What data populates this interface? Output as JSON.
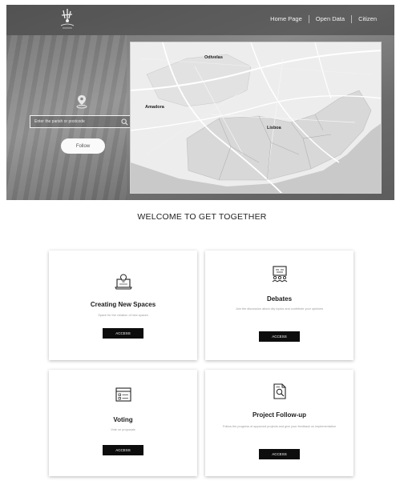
{
  "header": {
    "nav": [
      "Home Page",
      "Open Data",
      "Citizen"
    ]
  },
  "hero": {
    "search_placeholder": "Enter the parish or postcode",
    "follow_label": "Follow"
  },
  "map": {
    "labels": [
      "Odivelas",
      "Amadora",
      "Lisboa"
    ]
  },
  "welcome_title": "WELCOME TO GET TOGETHER",
  "cards": [
    {
      "title": "Creating New Spaces",
      "description": "Space for the creation of new spaces",
      "button": "ACCESS",
      "icon": "laptop-idea-icon"
    },
    {
      "title": "Debates",
      "description": "Join the discussion about city topics and contribute your opinions",
      "button": "ACCESS",
      "icon": "debate-board-icon"
    },
    {
      "title": "Voting",
      "description": "Vote on proposals",
      "button": "ACCESS",
      "icon": "ballot-icon"
    },
    {
      "title": "Project Follow-up",
      "description": "Follow the progress of approved projects and give your feedback on implementation",
      "button": "ACCESS",
      "icon": "document-magnifier-icon"
    }
  ]
}
